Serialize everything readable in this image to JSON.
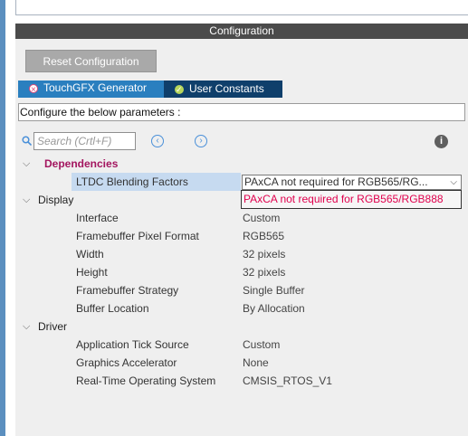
{
  "header": {
    "title": "Configuration"
  },
  "toolbar": {
    "reset_label": "Reset Configuration"
  },
  "tabs": [
    {
      "label": "TouchGFX Generator",
      "icon": "error-badge-icon"
    },
    {
      "label": "User Constants",
      "icon": "check-badge-icon"
    }
  ],
  "instruction": "Configure the below parameters :",
  "search": {
    "placeholder": "Search (Crtl+F)"
  },
  "groups": {
    "dependencies": {
      "label": "Dependencies",
      "rows": [
        {
          "label": "LTDC Blending Factors",
          "value": "PAxCA not required for RGB565/RG..."
        }
      ]
    },
    "display": {
      "label": "Display",
      "rows": [
        {
          "label": "Interface",
          "value": "Custom"
        },
        {
          "label": "Framebuffer Pixel Format",
          "value": "RGB565"
        },
        {
          "label": "Width",
          "value": "32 pixels"
        },
        {
          "label": "Height",
          "value": "32 pixels"
        },
        {
          "label": "Framebuffer Strategy",
          "value": "Single Buffer"
        },
        {
          "label": "Buffer Location",
          "value": "By Allocation"
        }
      ]
    },
    "driver": {
      "label": "Driver",
      "rows": [
        {
          "label": "Application Tick Source",
          "value": "Custom"
        },
        {
          "label": "Graphics Accelerator",
          "value": "None"
        },
        {
          "label": "Real-Time Operating System",
          "value": "CMSIS_RTOS_V1"
        }
      ]
    }
  },
  "dropdown": {
    "option": "PAxCA not required for RGB565/RGB888"
  },
  "colors": {
    "header_bg": "#4b4b4b",
    "tab_active": "#2a7fbf",
    "tab_inactive": "#0f3f6b",
    "group_accent": "#a3155f",
    "option_text": "#e0004d"
  }
}
